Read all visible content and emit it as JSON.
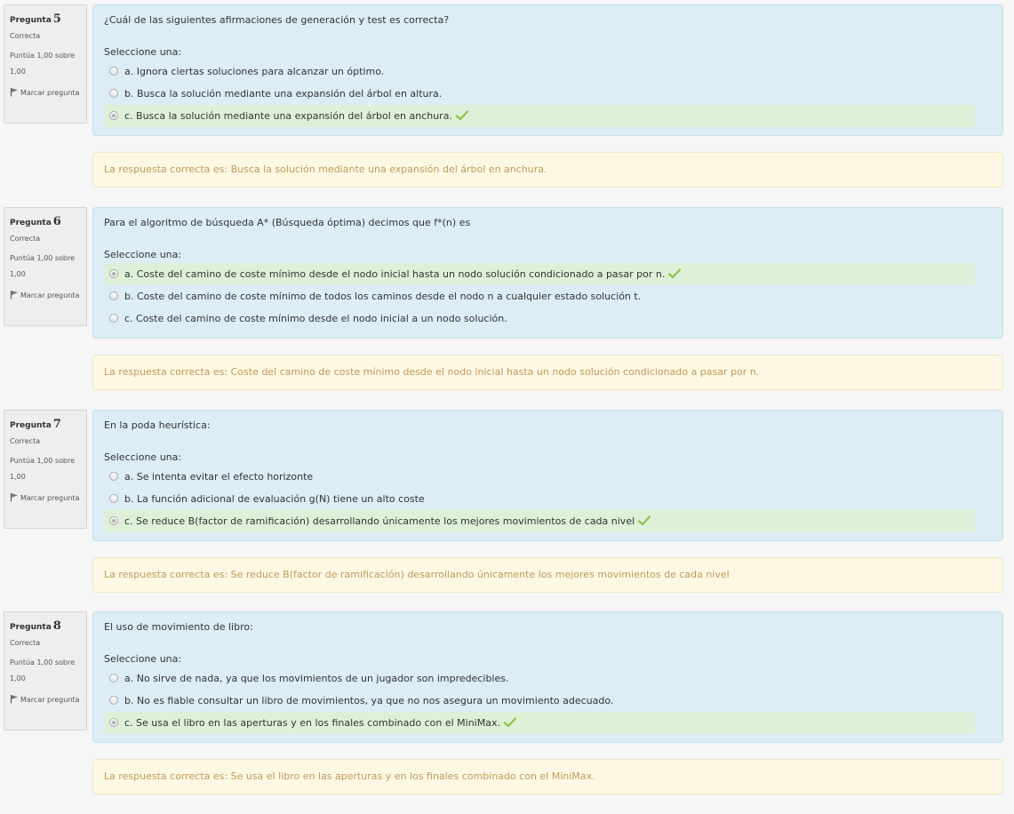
{
  "labels": {
    "question_word": "Pregunta",
    "state": "Correcta",
    "grade": "Puntúa 1,00 sobre 1,00",
    "flag": "Marcar pregunta",
    "prompt": "Seleccione una:",
    "feedback_prefix": "La respuesta correcta es: "
  },
  "colors": {
    "check": "#8bc34a",
    "correct_bg": "#dff0d8",
    "question_bg": "#dcedf6",
    "feedback_text": "#c09a5b"
  },
  "questions": [
    {
      "number": "5",
      "text": "¿Cuál de las siguientes afirmaciones de generación y test es correcta?",
      "options": [
        {
          "label": "a. Ignora ciertas soluciones para alcanzar un óptimo.",
          "selected": false,
          "correct": false
        },
        {
          "label": "b. Busca la solución mediante una expansión del árbol en altura.",
          "selected": false,
          "correct": false
        },
        {
          "label": "c. Busca la solución mediante una expansión del árbol en anchura.",
          "selected": true,
          "correct": true
        }
      ],
      "feedback": "La respuesta correcta es: Busca la solución mediante una expansión del árbol en anchura."
    },
    {
      "number": "6",
      "text": "Para el algoritmo de búsqueda A* (Búsqueda óptima) decimos que f*(n) es",
      "options": [
        {
          "label": "a. Coste del camino de coste mínimo desde el nodo inicial hasta un nodo solución condicionado a pasar por n.",
          "selected": true,
          "correct": true
        },
        {
          "label": "b. Coste del camino de coste mínimo de todos los caminos desde el nodo n a cualquier estado solución t.",
          "selected": false,
          "correct": false
        },
        {
          "label": "c. Coste del camino de coste mínimo desde el nodo inicial a un nodo solución.",
          "selected": false,
          "correct": false
        }
      ],
      "feedback": "La respuesta correcta es: Coste del camino de coste mínimo desde el nodo inicial hasta un nodo solución condicionado a pasar por n."
    },
    {
      "number": "7",
      "text": "En la poda heurística:",
      "options": [
        {
          "label": "a. Se intenta evitar el efecto horizonte",
          "selected": false,
          "correct": false
        },
        {
          "label": "b. La función adicional de evaluación g(N) tiene un alto coste",
          "selected": false,
          "correct": false
        },
        {
          "label": "c. Se reduce B(factor de ramificación) desarrollando únicamente los mejores movimientos de cada nivel",
          "selected": true,
          "correct": true
        }
      ],
      "feedback": "La respuesta correcta es: Se reduce B(factor de ramificación) desarrollando únicamente los mejores movimientos de cada nivel"
    },
    {
      "number": "8",
      "text": "El uso de movimiento de libro:",
      "options": [
        {
          "label": "a. No sirve de nada, ya que los movimientos de un jugador son impredecibles.",
          "selected": false,
          "correct": false
        },
        {
          "label": "b. No es fiable consultar un libro de movimientos, ya que no nos asegura un movimiento adecuado.",
          "selected": false,
          "correct": false
        },
        {
          "label": "c. Se usa el libro en las aperturas y en los finales combinado con el MiniMax.",
          "selected": true,
          "correct": true
        }
      ],
      "feedback": "La respuesta correcta es: Se usa el libro en las aperturas y en los finales combinado con el MiniMax."
    }
  ]
}
